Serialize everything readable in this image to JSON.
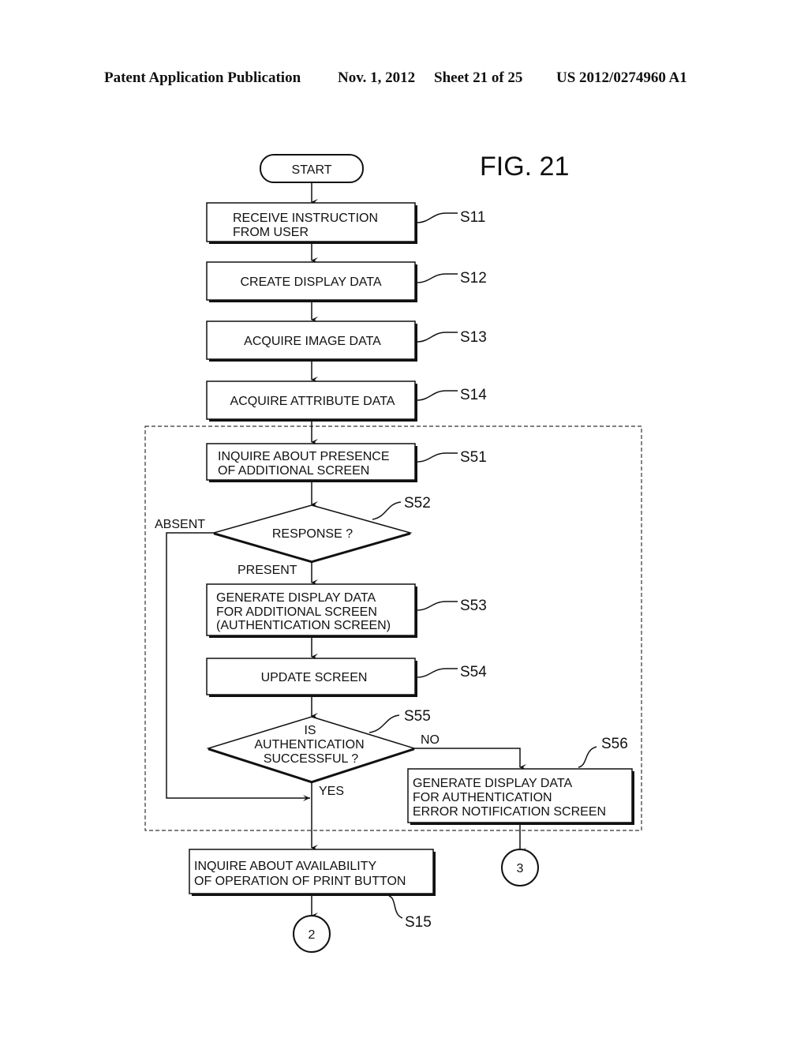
{
  "header": {
    "publication": "Patent Application Publication",
    "date": "Nov. 1, 2012",
    "sheet": "Sheet 21 of 25",
    "number": "US 2012/0274960 A1"
  },
  "figure_label": "FIG. 21",
  "start": "START",
  "steps": {
    "s11": {
      "id": "S11",
      "line1": "RECEIVE INSTRUCTION",
      "line2": "FROM USER"
    },
    "s12": {
      "id": "S12",
      "line1": "CREATE DISPLAY DATA"
    },
    "s13": {
      "id": "S13",
      "line1": "ACQUIRE IMAGE DATA"
    },
    "s14": {
      "id": "S14",
      "line1": "ACQUIRE ATTRIBUTE DATA"
    },
    "s51": {
      "id": "S51",
      "line1": "INQUIRE ABOUT PRESENCE",
      "line2": "OF ADDITIONAL SCREEN"
    },
    "s52": {
      "id": "S52",
      "line1": "RESPONSE ?"
    },
    "s53": {
      "id": "S53",
      "line1": "GENERATE DISPLAY DATA",
      "line2": "FOR ADDITIONAL SCREEN",
      "line3": "(AUTHENTICATION SCREEN)"
    },
    "s54": {
      "id": "S54",
      "line1": "UPDATE SCREEN"
    },
    "s55": {
      "id": "S55",
      "line1": "IS",
      "line2": "AUTHENTICATION",
      "line3": "SUCCESSFUL ?"
    },
    "s56": {
      "id": "S56",
      "line1": "GENERATE DISPLAY DATA",
      "line2": "FOR AUTHENTICATION",
      "line3": "ERROR NOTIFICATION SCREEN"
    },
    "s15": {
      "id": "S15",
      "line1": "INQUIRE ABOUT AVAILABILITY",
      "line2": "OF OPERATION OF PRINT BUTTON"
    }
  },
  "branches": {
    "absent": "ABSENT",
    "present": "PRESENT",
    "no": "NO",
    "yes": "YES"
  },
  "connectors": {
    "c2": "2",
    "c3": "3"
  }
}
